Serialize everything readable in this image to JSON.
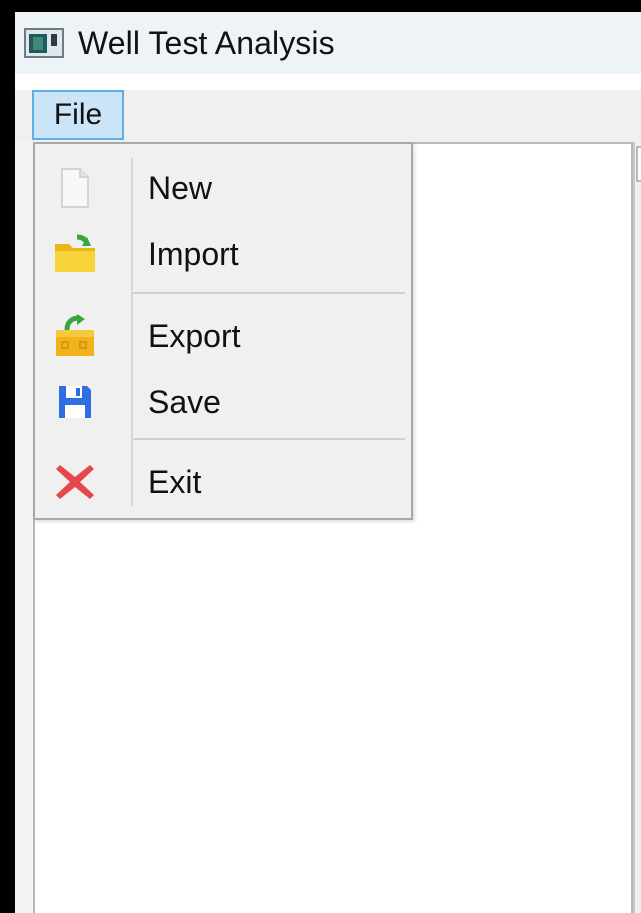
{
  "window": {
    "title": "Well Test Analysis",
    "icon": "app-window-icon"
  },
  "menubar": {
    "items": [
      {
        "label": "File",
        "state": "open"
      }
    ]
  },
  "file_menu": {
    "items": [
      {
        "label": "New",
        "icon": "new-document-icon"
      },
      {
        "label": "Import",
        "icon": "import-folder-icon"
      },
      {
        "label": "Export",
        "icon": "export-package-icon"
      },
      {
        "label": "Save",
        "icon": "save-floppy-icon"
      },
      {
        "label": "Exit",
        "icon": "exit-x-icon"
      }
    ]
  },
  "colors": {
    "menu_highlight": "#cce4f7",
    "menu_highlight_border": "#5ab0e6",
    "titlebar": "#eef3f6",
    "menu_background": "#f0f0f0",
    "exit_icon": "#e5474b",
    "save_icon": "#2f6fe4",
    "folder_icon": "#f2c51c"
  }
}
